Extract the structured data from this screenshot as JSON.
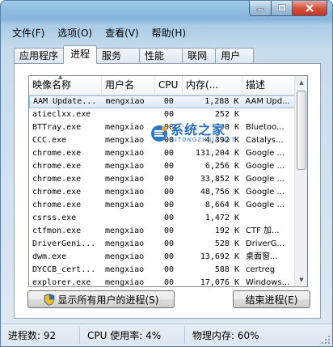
{
  "window": {
    "controls": {
      "minimize": "minimize",
      "maximize": "maximize",
      "close": "close"
    }
  },
  "menu": [
    {
      "label": "文件(F)"
    },
    {
      "label": "选项(O)"
    },
    {
      "label": "查看(V)"
    },
    {
      "label": "帮助(H)"
    }
  ],
  "tabs": [
    {
      "label": "应用程序",
      "active": false
    },
    {
      "label": "进程",
      "active": true
    },
    {
      "label": "服务",
      "active": false
    },
    {
      "label": "性能",
      "active": false
    },
    {
      "label": "联网",
      "active": false
    },
    {
      "label": "用户",
      "active": false
    }
  ],
  "table": {
    "columns": [
      "映像名称",
      "用户名",
      "CPU",
      "内存(...",
      "描述"
    ],
    "sort_column": "映像名称",
    "rows": [
      {
        "name": "AAM Update...",
        "user": "mengxiao",
        "cpu": "00",
        "mem": "1,288 K",
        "desc": "AAM Upd...",
        "selected": true
      },
      {
        "name": "atieclxx.exe",
        "user": "",
        "cpu": "00",
        "mem": "252 K",
        "desc": ""
      },
      {
        "name": "BTTray.exe",
        "user": "mengxiao",
        "cpu": "00",
        "mem": "940 K",
        "desc": "Bluetoo..."
      },
      {
        "name": "CCC.exe",
        "user": "mengxiao",
        "cpu": "00",
        "mem": "4,392 K",
        "desc": "Catalys..."
      },
      {
        "name": "chrome.exe",
        "user": "mengxiao",
        "cpu": "00",
        "mem": "131,204 K",
        "desc": "Google ..."
      },
      {
        "name": "chrome.exe",
        "user": "mengxiao",
        "cpu": "00",
        "mem": "6,256 K",
        "desc": "Google ..."
      },
      {
        "name": "chrome.exe",
        "user": "mengxiao",
        "cpu": "00",
        "mem": "33,852 K",
        "desc": "Google ..."
      },
      {
        "name": "chrome.exe",
        "user": "mengxiao",
        "cpu": "00",
        "mem": "48,756 K",
        "desc": "Google ..."
      },
      {
        "name": "chrome.exe",
        "user": "mengxiao",
        "cpu": "00",
        "mem": "8,664 K",
        "desc": "Google ..."
      },
      {
        "name": "csrss.exe",
        "user": "",
        "cpu": "00",
        "mem": "1,472 K",
        "desc": ""
      },
      {
        "name": "ctfmon.exe",
        "user": "mengxiao",
        "cpu": "00",
        "mem": "192 K",
        "desc": "CTF 加..."
      },
      {
        "name": "DriverGeni...",
        "user": "mengxiao",
        "cpu": "00",
        "mem": "528 K",
        "desc": "DriverG..."
      },
      {
        "name": "dwm.exe",
        "user": "mengxiao",
        "cpu": "00",
        "mem": "13,692 K",
        "desc": "桌面窗..."
      },
      {
        "name": "DYCCB_cert...",
        "user": "mengxiao",
        "cpu": "00",
        "mem": "588 K",
        "desc": "certreg"
      },
      {
        "name": "explorer.exe",
        "user": "mengxiao",
        "cpu": "00",
        "mem": "17,076 K",
        "desc": "Windows..."
      }
    ]
  },
  "buttons": {
    "show_all": "显示所有用户的进程(S)",
    "end_process": "结束进程(E)"
  },
  "status": {
    "processes": "进程数: 92",
    "cpu": "CPU 使用率: 4%",
    "memory": "物理内存: 60%"
  },
  "watermark": {
    "cn": "系统之家",
    "en": "XITONGZHIJIA.NET"
  }
}
